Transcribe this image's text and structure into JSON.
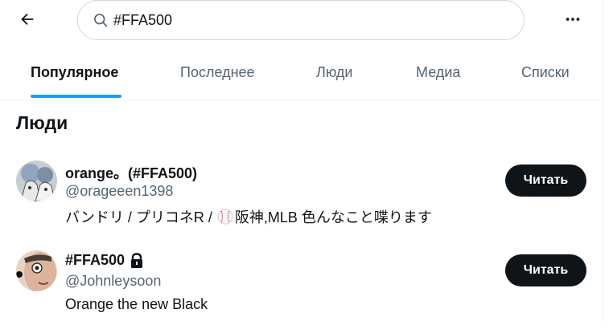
{
  "search": {
    "query": "#FFA500"
  },
  "tabs": [
    {
      "label": "Популярное",
      "active": true
    },
    {
      "label": "Последнее",
      "active": false
    },
    {
      "label": "Люди",
      "active": false
    },
    {
      "label": "Медиа",
      "active": false
    },
    {
      "label": "Списки",
      "active": false
    }
  ],
  "people": {
    "title": "Люди",
    "users": [
      {
        "display_name": "orange。(#FFA500)",
        "handle": "@orageeen1398",
        "bio_before": "バンドリ / プリコネR /",
        "bio_emoji": "baseball-icon",
        "bio_after": "阪神,MLB 色んなこと喋ります",
        "follow_label": "Читать"
      },
      {
        "display_name": "#FFA500",
        "protected": true,
        "handle": "@Johnleysoon",
        "bio": "Orange the new Black",
        "follow_label": "Читать"
      }
    ]
  },
  "colors": {
    "accent": "#1d9bf0",
    "text": "#0f1419",
    "secondary": "#536471"
  }
}
